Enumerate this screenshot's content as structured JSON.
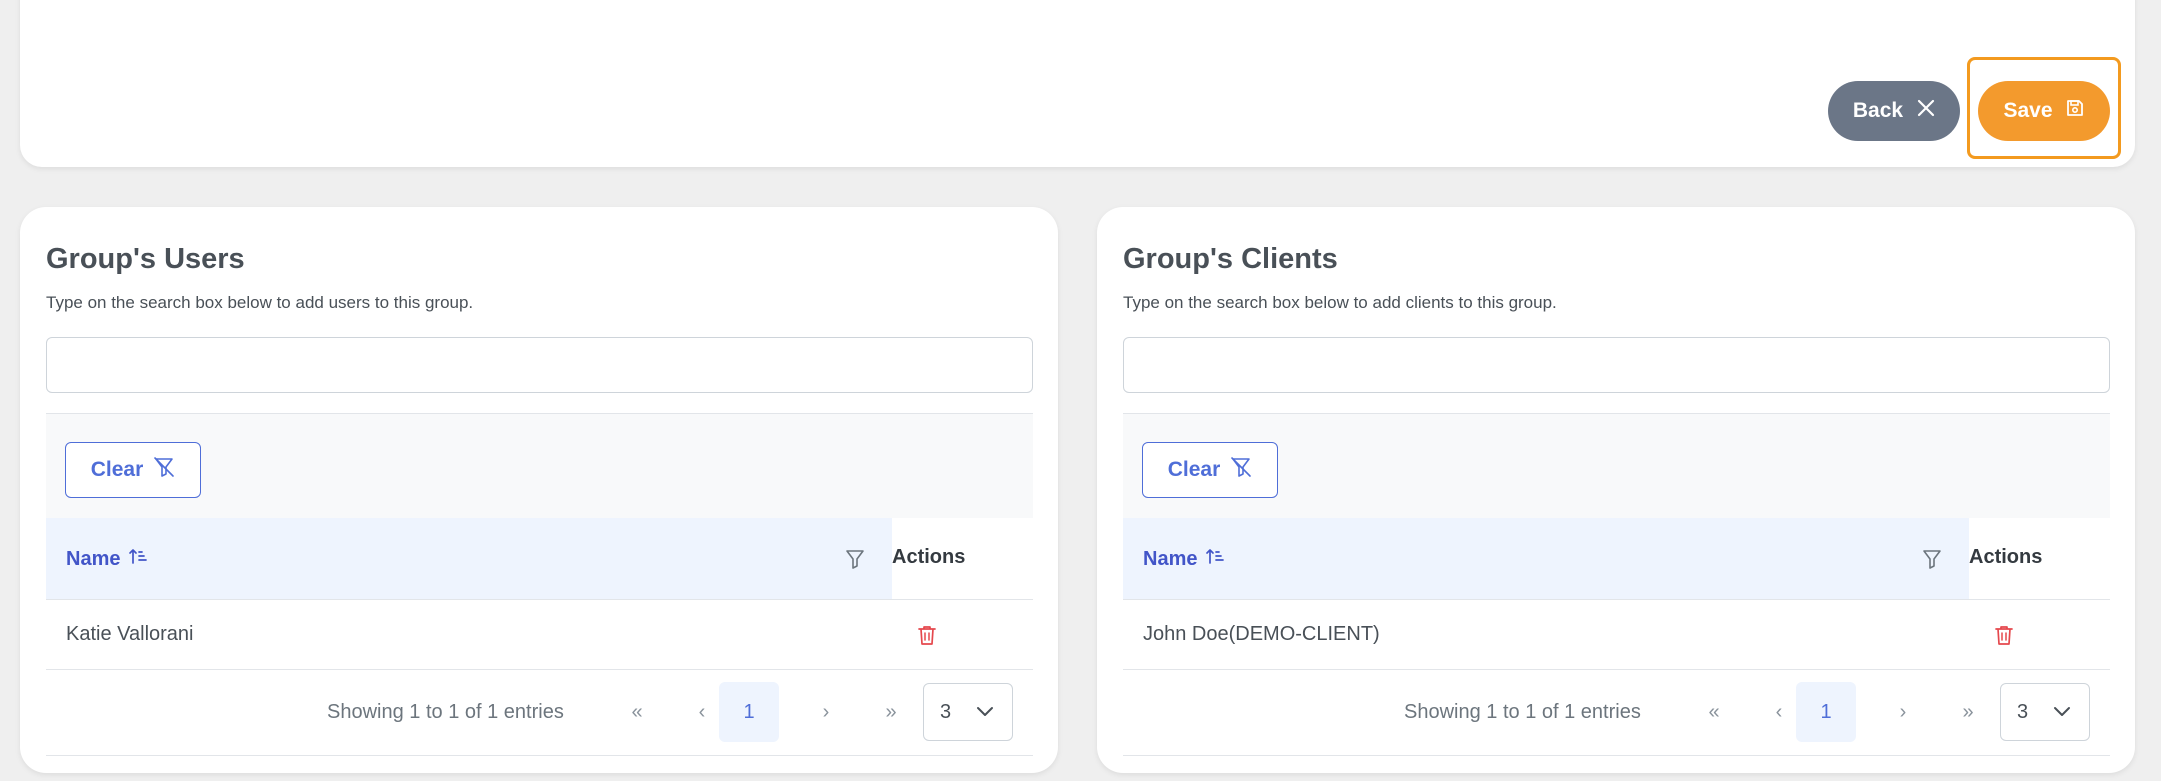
{
  "actions": {
    "back_label": "Back",
    "save_label": "Save"
  },
  "users_panel": {
    "title": "Group's Users",
    "description": "Type on the search box below to add users to this group.",
    "search_value": "",
    "clear_label": "Clear",
    "columns": {
      "name": "Name",
      "actions": "Actions"
    },
    "rows": [
      {
        "name": "Katie Vallorani"
      }
    ],
    "pagination": {
      "showing": "Showing 1 to 1 of 1 entries",
      "first": "«",
      "prev": "‹",
      "current_page": "1",
      "next": "›",
      "last": "»",
      "rows_per_page": "3"
    }
  },
  "clients_panel": {
    "title": "Group's Clients",
    "description": "Type on the search box below to add clients to this group.",
    "search_value": "",
    "clear_label": "Clear",
    "columns": {
      "name": "Name",
      "actions": "Actions"
    },
    "rows": [
      {
        "name": "John Doe(DEMO-CLIENT)"
      }
    ],
    "pagination": {
      "showing": "Showing 1 to 1 of 1 entries",
      "first": "«",
      "prev": "‹",
      "current_page": "1",
      "next": "›",
      "last": "»",
      "rows_per_page": "3"
    }
  },
  "colors": {
    "accent_orange": "#f39a2d",
    "back_gray": "#6b7687",
    "primary_blue": "#4f6ed8",
    "header_blue_bg": "#eef4fe",
    "delete_red": "#e5484d"
  },
  "icons": {
    "back": "close-icon",
    "save": "save-icon",
    "clear": "filter-slash-icon",
    "sort": "sort-amount-up-icon",
    "filter": "filter-icon",
    "delete": "trash-icon",
    "rows_select": "chevron-down-icon"
  }
}
